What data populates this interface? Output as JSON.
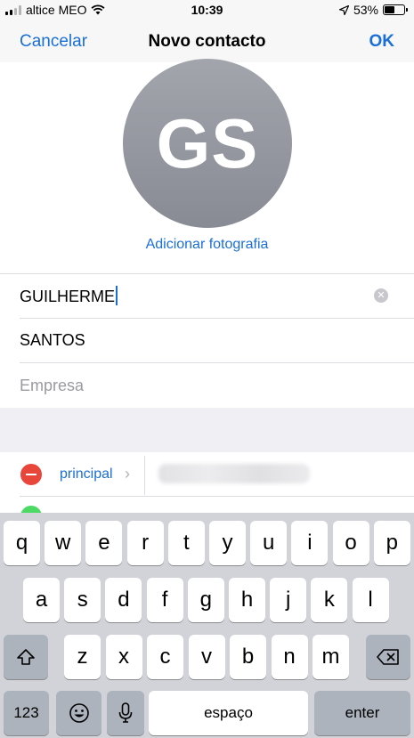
{
  "status_bar": {
    "carrier": "altice MEO",
    "time": "10:39",
    "battery": "53%",
    "battery_level": 0.53,
    "icons": [
      "signal-icon",
      "wifi-icon",
      "location-icon",
      "battery-icon"
    ]
  },
  "nav": {
    "cancel": "Cancelar",
    "title": "Novo contacto",
    "ok": "OK"
  },
  "avatar": {
    "initials": "GS",
    "add_photo": "Adicionar fotografia"
  },
  "fields": {
    "first_name": "GUILHERME",
    "last_name": "SANTOS",
    "company_placeholder": "Empresa"
  },
  "phone": {
    "label": "principal",
    "chevron": "›"
  },
  "keyboard": {
    "row1": [
      "q",
      "w",
      "e",
      "r",
      "t",
      "y",
      "u",
      "i",
      "o",
      "p"
    ],
    "row2": [
      "a",
      "s",
      "d",
      "f",
      "g",
      "h",
      "j",
      "k",
      "l"
    ],
    "row3": [
      "z",
      "x",
      "c",
      "v",
      "b",
      "n",
      "m"
    ],
    "numbers": "123",
    "space": "espaço",
    "enter": "enter",
    "icons": [
      "shift-icon",
      "backspace-icon",
      "emoji-icon",
      "microphone-icon"
    ]
  },
  "colors": {
    "accent": "#1a6fd6",
    "delete_red": "#e8463a",
    "add_green": "#4cd964"
  }
}
